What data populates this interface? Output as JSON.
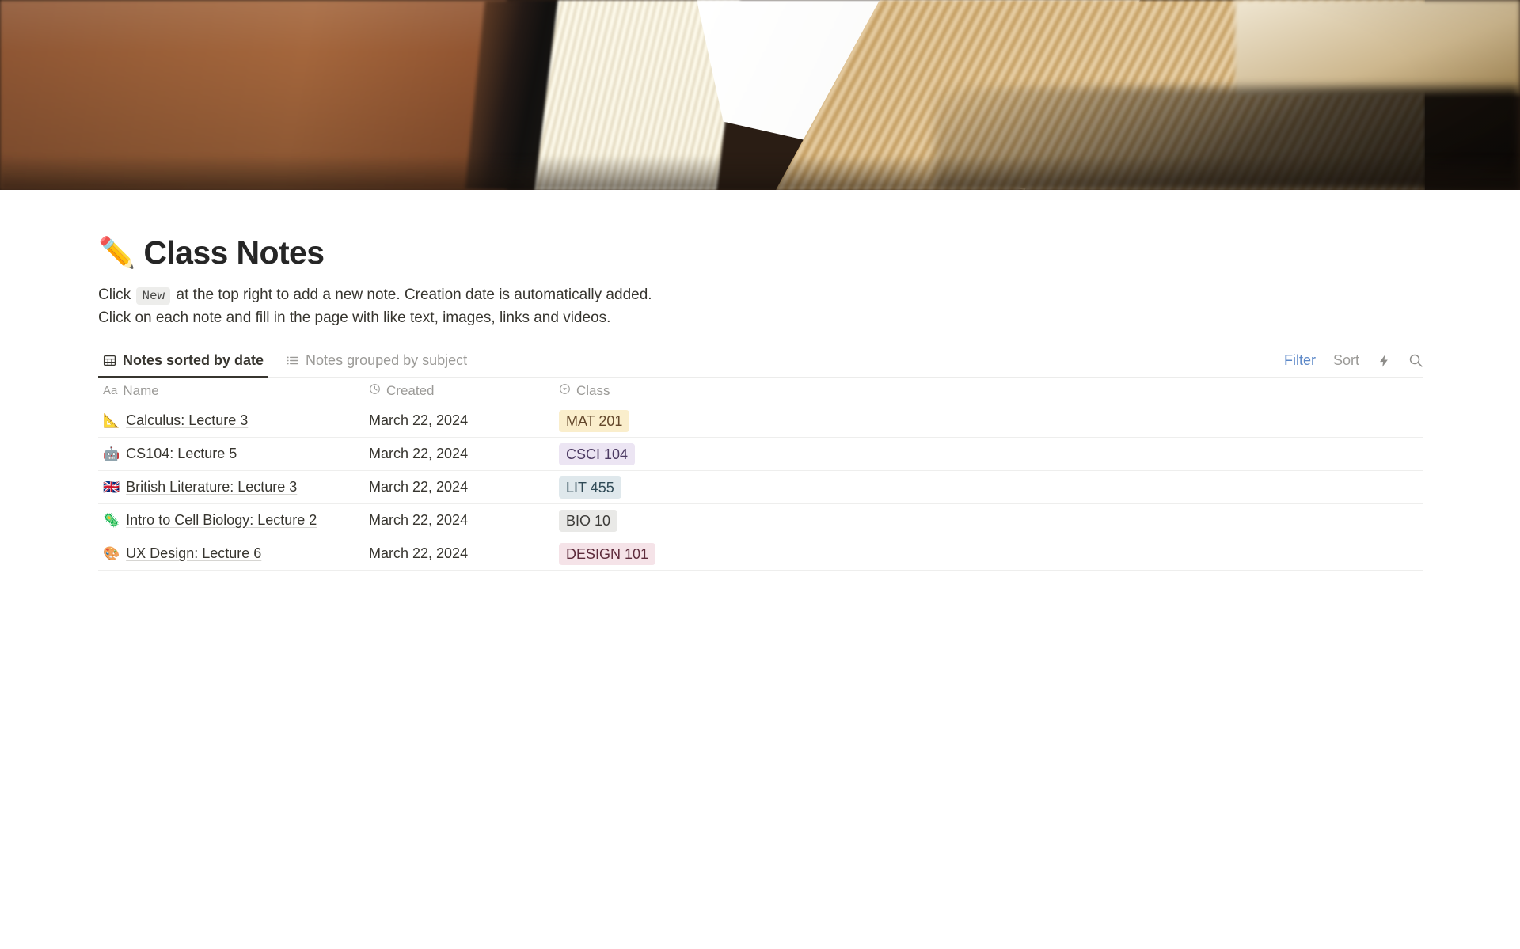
{
  "cover": {
    "alt": "blurred photo of an open book on a wooden desk"
  },
  "header": {
    "emoji": "✏️",
    "title": "Class Notes",
    "description_line1_before": "Click",
    "description_chip": "New",
    "description_line1_after": "at the top right to add a new note. Creation date is automatically added.",
    "description_line2": "Click on each note and fill in the page with like text, images, links and videos."
  },
  "tabs": [
    {
      "label": "Notes sorted by date",
      "icon": "table-icon",
      "active": true
    },
    {
      "label": "Notes grouped by subject",
      "icon": "list-icon",
      "active": false
    }
  ],
  "toolbar": {
    "filter_label": "Filter",
    "sort_label": "Sort",
    "filter_color": "#5b87c7",
    "sort_color": "#9b9a97",
    "lightning_icon": "lightning-icon",
    "search_icon": "search-icon"
  },
  "table": {
    "columns": [
      {
        "label": "Name",
        "icon": "text-type-icon"
      },
      {
        "label": "Created",
        "icon": "clock-icon"
      },
      {
        "label": "Class",
        "icon": "select-type-icon"
      }
    ],
    "rows": [
      {
        "emoji": "📐",
        "name": "Calculus: Lecture 3",
        "created": "March 22, 2024",
        "class": "MAT 201",
        "tag_bg": "#faeecc",
        "tag_fg": "#63472b"
      },
      {
        "emoji": "🤖",
        "name": "CS104: Lecture 5",
        "created": "March 22, 2024",
        "class": "CSCI 104",
        "tag_bg": "#ece5f3",
        "tag_fg": "#4c3a62"
      },
      {
        "emoji": "🇬🇧",
        "name": "British Literature: Lecture 3",
        "created": "March 22, 2024",
        "class": "LIT 455",
        "tag_bg": "#dfe8ec",
        "tag_fg": "#2f4a56"
      },
      {
        "emoji": "🦠",
        "name": "Intro to Cell Biology: Lecture 2",
        "created": "March 22, 2024",
        "class": "BIO 10",
        "tag_bg": "#e9e9e7",
        "tag_fg": "#3c3b38"
      },
      {
        "emoji": "🎨",
        "name": "UX Design: Lecture 6",
        "created": "March 22, 2024",
        "class": "DESIGN 101",
        "tag_bg": "#f5e3e8",
        "tag_fg": "#5e2c3c"
      }
    ]
  }
}
